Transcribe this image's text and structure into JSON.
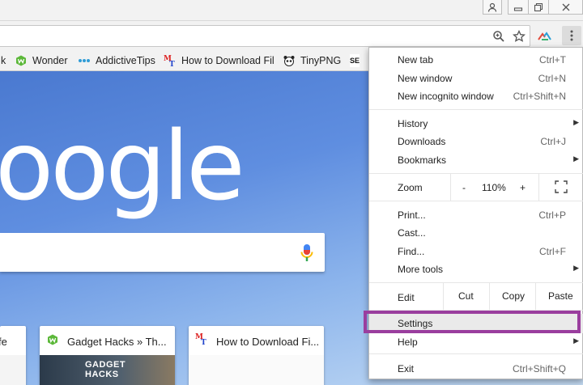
{
  "colors": {
    "accent_highlight": "#9a3e9e",
    "page_background_top": "#4a79d0",
    "page_background_bottom": "#c5dcf4"
  },
  "window": {
    "buttons": [
      "user-icon",
      "minimize-icon",
      "restore-icon",
      "close-icon"
    ]
  },
  "toolbar": {
    "icons": [
      "zoom-icon",
      "star-icon",
      "extension-icon",
      "menu-dots-icon"
    ]
  },
  "bookmarks": [
    {
      "label": "k",
      "icon": "none"
    },
    {
      "label": "Wonder",
      "icon": "wonderhowto-icon"
    },
    {
      "label": "AddictiveTips",
      "icon": "dots-icon"
    },
    {
      "label": "How to Download Fil",
      "icon": "mt-icon"
    },
    {
      "label": "TinyPNG",
      "icon": "panda-icon"
    },
    {
      "label": "SE",
      "icon": "se-icon"
    }
  ],
  "page": {
    "logo_text": "oogle",
    "tiles": [
      {
        "title": "fe",
        "thumb": ""
      },
      {
        "title": "Gadget Hacks » Th...",
        "thumb": "GADGET HACKS"
      },
      {
        "title": "How to Download Fi...",
        "thumb": ""
      }
    ]
  },
  "menu": {
    "new_tab": {
      "label": "New tab",
      "shortcut": "Ctrl+T"
    },
    "new_window": {
      "label": "New window",
      "shortcut": "Ctrl+N"
    },
    "new_incognito": {
      "label": "New incognito window",
      "shortcut": "Ctrl+Shift+N"
    },
    "history": {
      "label": "History"
    },
    "downloads": {
      "label": "Downloads",
      "shortcut": "Ctrl+J"
    },
    "bookmarks": {
      "label": "Bookmarks"
    },
    "zoom": {
      "label": "Zoom",
      "minus": "-",
      "level": "110%",
      "plus": "+"
    },
    "print": {
      "label": "Print...",
      "shortcut": "Ctrl+P"
    },
    "cast": {
      "label": "Cast..."
    },
    "find": {
      "label": "Find...",
      "shortcut": "Ctrl+F"
    },
    "more_tools": {
      "label": "More tools"
    },
    "edit": {
      "label": "Edit",
      "cut": "Cut",
      "copy": "Copy",
      "paste": "Paste"
    },
    "settings": {
      "label": "Settings"
    },
    "help": {
      "label": "Help"
    },
    "exit": {
      "label": "Exit",
      "shortcut": "Ctrl+Shift+Q"
    }
  }
}
